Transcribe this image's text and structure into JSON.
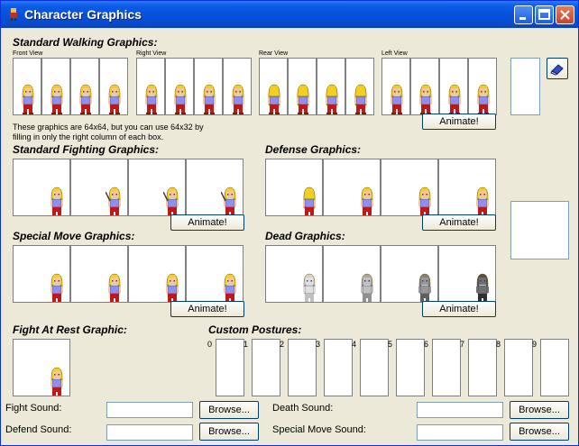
{
  "window": {
    "title": "Character Graphics"
  },
  "walking": {
    "label": "Standard Walking Graphics:",
    "views": [
      "Front View",
      "Right View",
      "Rear View",
      "Left View"
    ],
    "note": "These graphics are 64x64, but you can use 64x32 by filling in only the right column of each box.",
    "animate_label": "Animate!"
  },
  "fighting": {
    "label": "Standard Fighting Graphics:",
    "animate_label": "Animate!"
  },
  "defense": {
    "label": "Defense Graphics:",
    "animate_label": "Animate!"
  },
  "special": {
    "label": "Special Move Graphics:",
    "animate_label": "Animate!"
  },
  "dead": {
    "label": "Dead Graphics:",
    "animate_label": "Animate!"
  },
  "rest": {
    "label": "Fight At Rest Graphic:"
  },
  "custom": {
    "label": "Custom Postures:",
    "numbers": [
      "0",
      "1",
      "2",
      "3",
      "4",
      "5",
      "6",
      "7",
      "8",
      "9"
    ]
  },
  "sounds": {
    "fight_label": "Fight Sound:",
    "defend_label": "Defend Sound:",
    "death_label": "Death Sound:",
    "special_label": "Special Move Sound:",
    "browse_label": "Browse...",
    "fight_value": "",
    "defend_value": "",
    "death_value": "",
    "special_value": ""
  },
  "colors": {
    "titlebar": "#0a5ae6",
    "hair": "#f0d020",
    "shirt": "#8f8ff0",
    "pants": "#c01818"
  },
  "icons": [
    "app-icon",
    "minimize-icon",
    "maximize-icon",
    "close-icon",
    "eraser-icon"
  ]
}
